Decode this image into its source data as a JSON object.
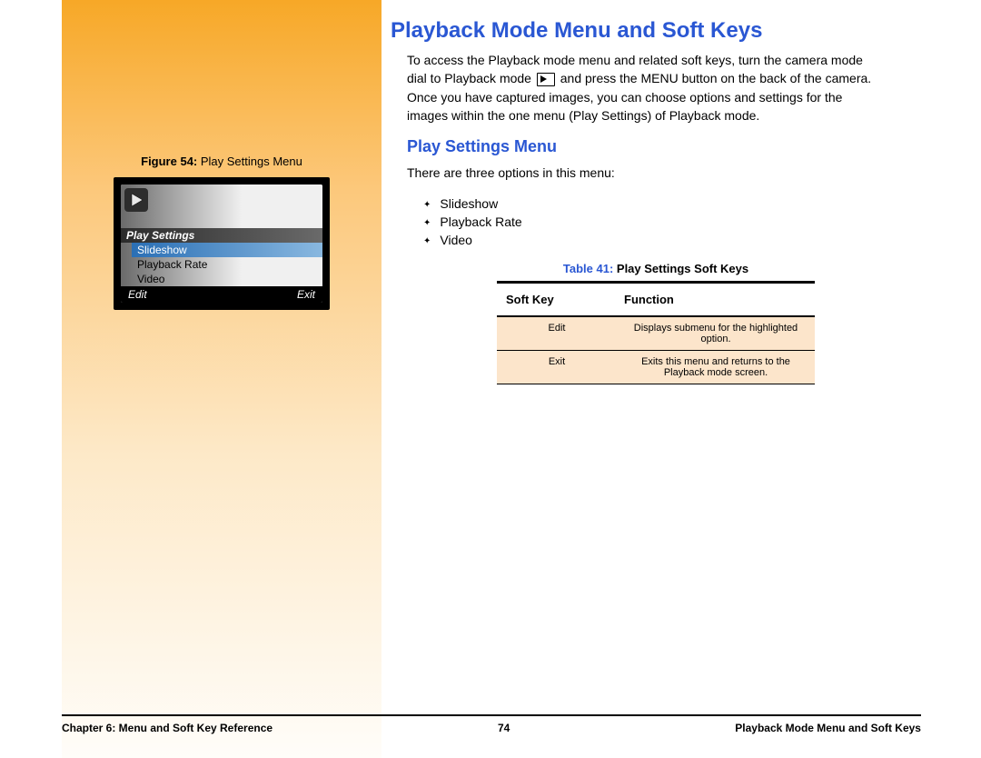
{
  "title": "Playback Mode Menu and Soft Keys",
  "para1a": "To access the Playback mode menu and related soft keys, turn the camera mode dial to Playback mode ",
  "para1b": " and press the MENU button on the back of the camera. Once you have captured images, you can choose options and settings for the images within the one menu (Play Settings) of Playback mode.",
  "subtitle": "Play Settings Menu",
  "para2": "There are three options in this menu:",
  "bullets": [
    "Slideshow",
    "Playback Rate",
    "Video"
  ],
  "figure": {
    "label": "Figure 54:",
    "text": " Play Settings Menu"
  },
  "lcd": {
    "header": "Play Settings",
    "selected": "Slideshow",
    "item2": "Playback Rate",
    "item3": "Video",
    "left": "Edit",
    "right": "Exit"
  },
  "table": {
    "captionLabel": "Table 41:",
    "captionText": " Play Settings Soft Keys",
    "h1": "Soft Key",
    "h2": "Function",
    "rows": [
      {
        "k": "Edit",
        "f": "Displays submenu for the highlighted option."
      },
      {
        "k": "Exit",
        "f": "Exits this menu and returns to the Playback mode screen."
      }
    ]
  },
  "footer": {
    "left": "Chapter 6: Menu and Soft Key Reference",
    "center": "74",
    "right": "Playback Mode Menu and Soft Keys"
  }
}
